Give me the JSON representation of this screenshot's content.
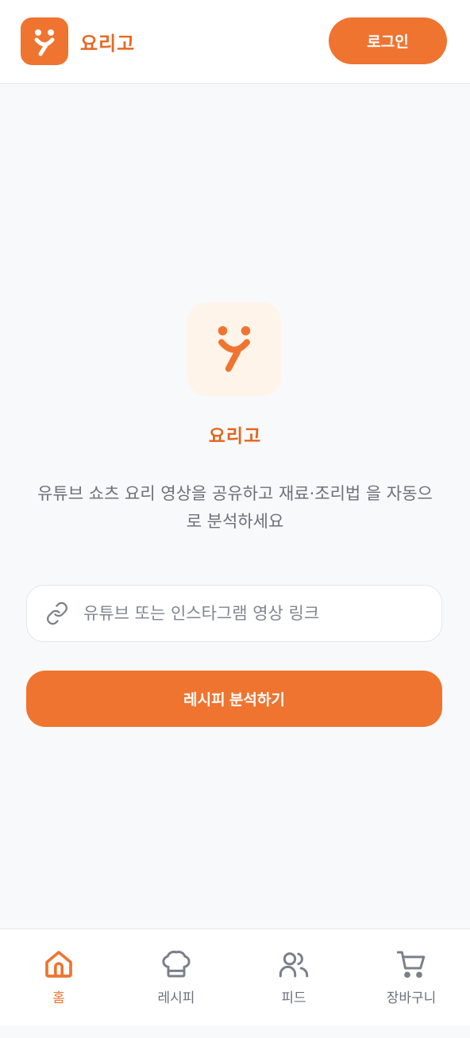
{
  "app": {
    "brand_name": "요리고",
    "accent_color": "#ef7430",
    "logo_icon": "fork-smile-icon"
  },
  "header": {
    "login_label": "로그인"
  },
  "hero": {
    "title": "요리고",
    "description": "유튜브 쇼츠 요리 영상을 공유하고 재료·조리법 을 자동으로 분석하세요"
  },
  "form": {
    "url_placeholder": "유튜브 또는 인스타그램 영상 링크",
    "url_value": "",
    "link_icon": "link-icon",
    "submit_label": "레시피 분석하기"
  },
  "bottom_nav": {
    "items": [
      {
        "label": "홈",
        "icon": "home-icon",
        "active": true
      },
      {
        "label": "레시피",
        "icon": "chef-hat-icon",
        "active": false
      },
      {
        "label": "피드",
        "icon": "users-icon",
        "active": false
      },
      {
        "label": "장바구니",
        "icon": "cart-icon",
        "active": false
      }
    ]
  }
}
